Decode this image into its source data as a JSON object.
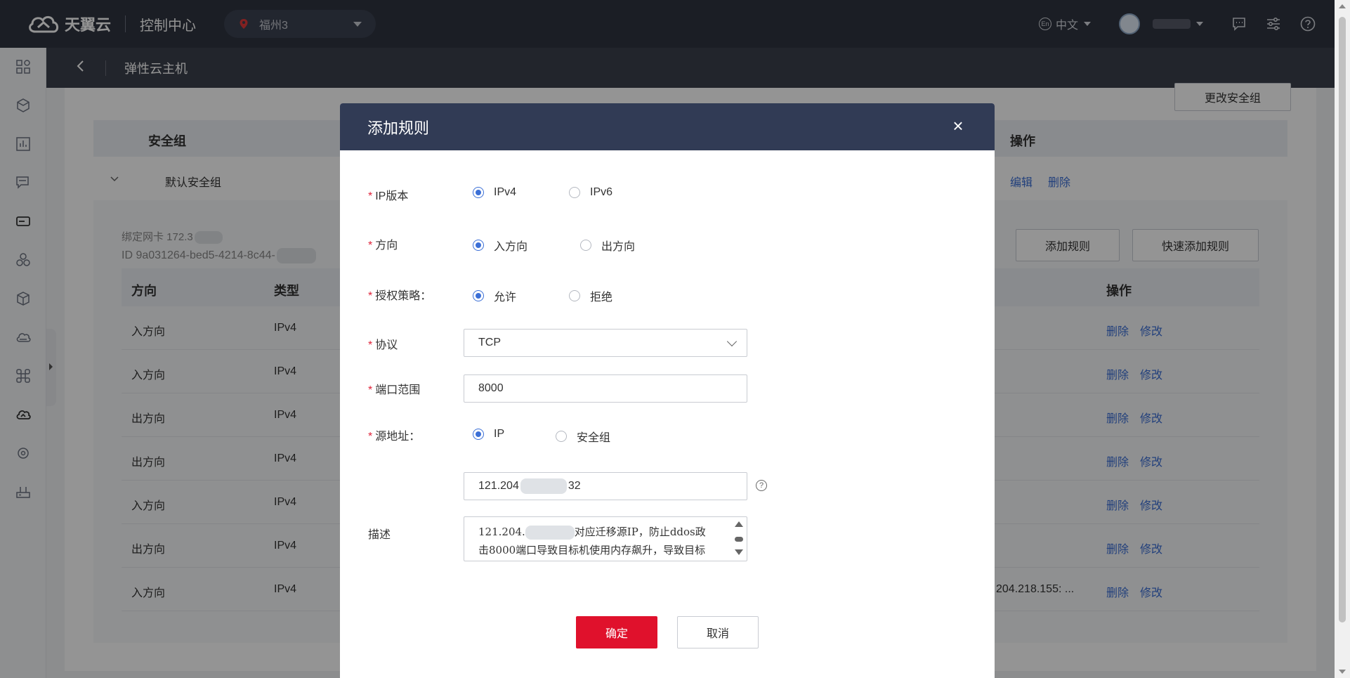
{
  "brand": {
    "name": "天翼云",
    "console": "控制中心"
  },
  "region": {
    "value": "福州3"
  },
  "topbar": {
    "language": "中文",
    "lang_icon": "En"
  },
  "subheader": {
    "title": "弹性云主机"
  },
  "security_group": {
    "change_button": "更改安全组",
    "columns": {
      "name": "安全组",
      "action": "操作"
    },
    "row": {
      "name": "默认安全组",
      "edit": "编辑",
      "delete": "删除"
    },
    "nic_label": "绑定网卡 172.3",
    "id_label": "ID 9a031264-bed5-4214-8c44-",
    "add_rule_button": "添加规则",
    "quick_add_button": "快速添加规则"
  },
  "rules_table": {
    "columns": {
      "direction": "方向",
      "type": "类型",
      "action": "操作"
    },
    "rows": [
      {
        "direction": "入方向",
        "type": "IPv4",
        "extra": ""
      },
      {
        "direction": "入方向",
        "type": "IPv4",
        "extra": ""
      },
      {
        "direction": "出方向",
        "type": "IPv4",
        "extra": ""
      },
      {
        "direction": "出方向",
        "type": "IPv4",
        "extra": ""
      },
      {
        "direction": "入方向",
        "type": "IPv4",
        "extra": ""
      },
      {
        "direction": "出方向",
        "type": "IPv4",
        "extra": ""
      },
      {
        "direction": "入方向",
        "type": "IPv4",
        "extra": "204.218.155: ..."
      }
    ],
    "delete_label": "删除",
    "modify_label": "修改"
  },
  "modal": {
    "title": "添加规则",
    "close_symbol": "×",
    "ip_version": {
      "label": "IP版本",
      "options": [
        "IPv4",
        "IPv6"
      ],
      "selected": "IPv4"
    },
    "direction": {
      "label": "方向",
      "options": [
        "入方向",
        "出方向"
      ],
      "selected": "入方向"
    },
    "policy": {
      "label": "授权策略：",
      "options": [
        "允许",
        "拒绝"
      ],
      "selected": "允许"
    },
    "protocol": {
      "label": "协议",
      "value": "TCP"
    },
    "port_range": {
      "label": "端口范围",
      "value": "8000"
    },
    "source": {
      "label": "源地址：",
      "options": [
        "IP",
        "安全组"
      ],
      "selected": "IP"
    },
    "ip_input": {
      "prefix": "121.204",
      "suffix": "32"
    },
    "help_symbol": "?",
    "description": {
      "label": "描述",
      "line1_prefix": "121.204.",
      "line1_suffix": "对应迁移源IP，防止ddos政",
      "line2": "击8000端口导致目标机使用内存飙升，导致目标"
    },
    "confirm": "确定",
    "cancel": "取消"
  },
  "colors": {
    "primary": "#e0112c",
    "link": "#3b6fd6",
    "topbar": "#2f3440",
    "modal_header": "#313b55"
  }
}
